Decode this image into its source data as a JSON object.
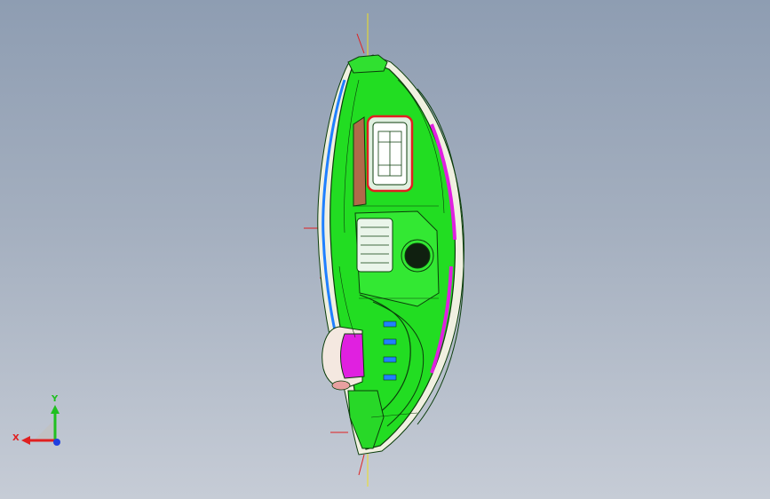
{
  "viewport": {
    "background_top": "#8e9db2",
    "background_bottom": "#c6ccd6"
  },
  "model": {
    "body_color": "#22dd22",
    "edge_color": "#0b3d0b",
    "highlight_color": "#e020e0",
    "rim_color": "#f0f0e0",
    "accent_red": "#e02020",
    "accent_blue": "#2080ff",
    "centerline_color": "#f0e020"
  },
  "triad": {
    "x_label": "X",
    "y_label": "Y",
    "x_color": "#e02020",
    "y_color": "#20c020",
    "z_color": "#2040e0"
  }
}
